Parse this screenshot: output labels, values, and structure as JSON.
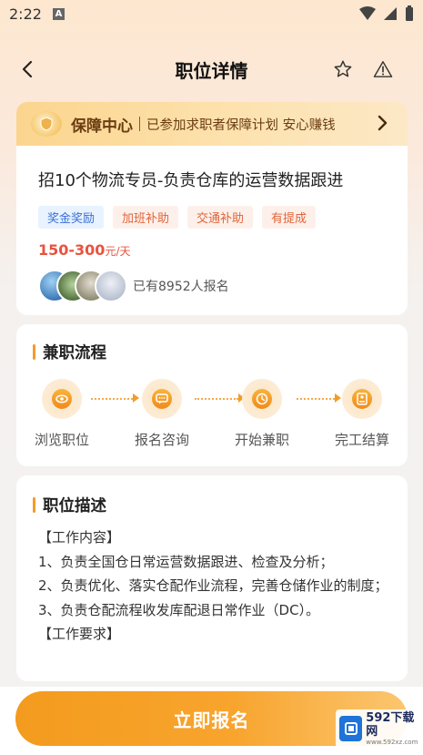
{
  "status_bar": {
    "time": "2:22",
    "notification_badge": "A"
  },
  "nav": {
    "title": "职位详情",
    "back_icon": "back-arrow-icon",
    "star_icon": "star-icon",
    "report_icon": "warning-icon"
  },
  "guarantee": {
    "title": "保障中心",
    "desc": "已参加求职者保障计划 安心赚钱"
  },
  "job": {
    "title": "招10个物流专员-负责仓库的运营数据跟进",
    "tags": [
      {
        "label": "奖金奖励",
        "color": "blue"
      },
      {
        "label": "加班补助",
        "color": "orange"
      },
      {
        "label": "交通补助",
        "color": "orange"
      },
      {
        "label": "有提成",
        "color": "orange"
      }
    ],
    "salary": "150-300",
    "salary_unit": "元/天",
    "applicants_text": "已有8952人报名"
  },
  "process": {
    "title": "兼职流程",
    "steps": [
      {
        "label": "浏览职位",
        "icon": "eye-icon"
      },
      {
        "label": "报名咨询",
        "icon": "chat-icon"
      },
      {
        "label": "开始兼职",
        "icon": "clock-icon"
      },
      {
        "label": "完工结算",
        "icon": "settlement-icon"
      }
    ]
  },
  "description": {
    "title": "职位描述",
    "lines": [
      "【工作内容】",
      "1、负责全国仓日常运营数据跟进、检查及分析；",
      "2、负责优化、落实仓配作业流程，完善仓储作业的制度；",
      "3、负责仓配流程收发库配退日常作业（DC）。",
      "【工作要求】"
    ]
  },
  "cta": {
    "label": "立即报名"
  },
  "watermark": {
    "main": "592下载网",
    "sub": "www.592xz.com"
  },
  "colors": {
    "accent": "#f59b2a",
    "salary": "#e8533f",
    "tag_blue": "#3a6fd8",
    "tag_orange": "#e0653b"
  }
}
